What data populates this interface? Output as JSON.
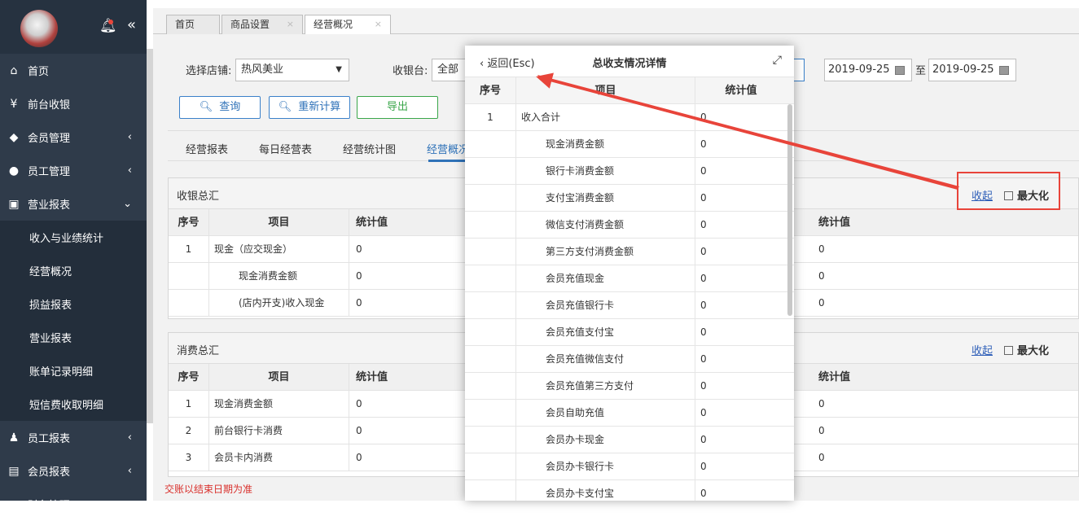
{
  "sidebar": {
    "items": [
      {
        "label": "首页",
        "icon": "home-icon",
        "glyph": "⌂",
        "arrow": ""
      },
      {
        "label": "前台收银",
        "icon": "yen-icon",
        "glyph": "¥",
        "arrow": ""
      },
      {
        "label": "会员管理",
        "icon": "diamond-icon",
        "glyph": "◆",
        "arrow": "‹"
      },
      {
        "label": "员工管理",
        "icon": "user-icon",
        "glyph": "●",
        "arrow": "‹"
      },
      {
        "label": "营业报表",
        "icon": "monitor-icon",
        "glyph": "▣",
        "arrow": "⌄"
      },
      {
        "label": "收入与业绩统计",
        "sub": true
      },
      {
        "label": "经营概况",
        "sub": true
      },
      {
        "label": "损益报表",
        "sub": true
      },
      {
        "label": "营业报表",
        "sub": true
      },
      {
        "label": "账单记录明细",
        "sub": true
      },
      {
        "label": "短信费收取明细",
        "sub": true
      },
      {
        "label": "员工报表",
        "icon": "staff-report-icon",
        "glyph": "♟",
        "arrow": "‹"
      },
      {
        "label": "会员报表",
        "icon": "member-report-icon",
        "glyph": "▤",
        "arrow": "‹"
      },
      {
        "label": "财务管理",
        "icon": "finance-icon",
        "glyph": "▥",
        "arrow": "‹"
      }
    ]
  },
  "tabs": [
    {
      "label": "首页"
    },
    {
      "label": "商品设置",
      "close": "×"
    },
    {
      "label": "经营概况",
      "close": "×"
    }
  ],
  "filters": {
    "store_label": "选择店铺:",
    "store_value": "热风美业",
    "cashier_label": "收银台:",
    "cashier_value": "全部",
    "date_from": "2019-09-25",
    "date_sep": "至",
    "date_to": "2019-09-25",
    "query_btn": "查询",
    "recalc_btn": "重新计算",
    "export_btn": "导出"
  },
  "subtabs": [
    "经营报表",
    "每日经营表",
    "经营统计图",
    "经营概况"
  ],
  "panel1": {
    "title": "收银总汇",
    "collapse": "收起",
    "maximize": "最大化",
    "headers": [
      "序号",
      "项目",
      "统计值",
      "统计值"
    ],
    "rows": [
      {
        "no": "1",
        "item": "现金（应交现金）",
        "value": "0",
        "value2": "0",
        "indent": false
      },
      {
        "no": "",
        "item": "现金消费金额",
        "value": "0",
        "value2": "0",
        "indent": true
      },
      {
        "no": "",
        "item": "(店内开支)收入现金",
        "value": "0",
        "value2": "0",
        "indent": true
      }
    ]
  },
  "panel2": {
    "title": "消费总汇",
    "collapse": "收起",
    "maximize": "最大化",
    "headers": [
      "序号",
      "项目",
      "统计值",
      "统计值"
    ],
    "rows": [
      {
        "no": "1",
        "item": "现金消费金额",
        "value": "0",
        "value2": "0"
      },
      {
        "no": "2",
        "item": "前台银行卡消费",
        "value": "0",
        "value2": "0"
      },
      {
        "no": "3",
        "item": "会员卡内消费",
        "value": "0",
        "value2": "0"
      }
    ]
  },
  "note": "交账以结束日期为准",
  "modal": {
    "back": "返回(Esc)",
    "title": "总收支情况详情",
    "headers": [
      "序号",
      "项目",
      "统计值"
    ],
    "rows": [
      {
        "no": "1",
        "item": "收入合计",
        "value": "0",
        "indent": false
      },
      {
        "no": "",
        "item": "现金消费金额",
        "value": "0",
        "indent": true
      },
      {
        "no": "",
        "item": "银行卡消费金额",
        "value": "0",
        "indent": true
      },
      {
        "no": "",
        "item": "支付宝消费金额",
        "value": "0",
        "indent": true
      },
      {
        "no": "",
        "item": "微信支付消费金额",
        "value": "0",
        "indent": true
      },
      {
        "no": "",
        "item": "第三方支付消费金额",
        "value": "0",
        "indent": true
      },
      {
        "no": "",
        "item": "会员充值现金",
        "value": "0",
        "indent": true
      },
      {
        "no": "",
        "item": "会员充值银行卡",
        "value": "0",
        "indent": true
      },
      {
        "no": "",
        "item": "会员充值支付宝",
        "value": "0",
        "indent": true
      },
      {
        "no": "",
        "item": "会员充值微信支付",
        "value": "0",
        "indent": true
      },
      {
        "no": "",
        "item": "会员充值第三方支付",
        "value": "0",
        "indent": true
      },
      {
        "no": "",
        "item": "会员自助充值",
        "value": "0",
        "indent": true
      },
      {
        "no": "",
        "item": "会员办卡现金",
        "value": "0",
        "indent": true
      },
      {
        "no": "",
        "item": "会员办卡银行卡",
        "value": "0",
        "indent": true
      },
      {
        "no": "",
        "item": "会员办卡支付宝",
        "value": "0",
        "indent": true
      }
    ]
  },
  "colors": {
    "accent": "#2f72b8",
    "sidebar": "#2f3b4a",
    "annotation": "#e8443a",
    "export": "#3aa64a"
  }
}
